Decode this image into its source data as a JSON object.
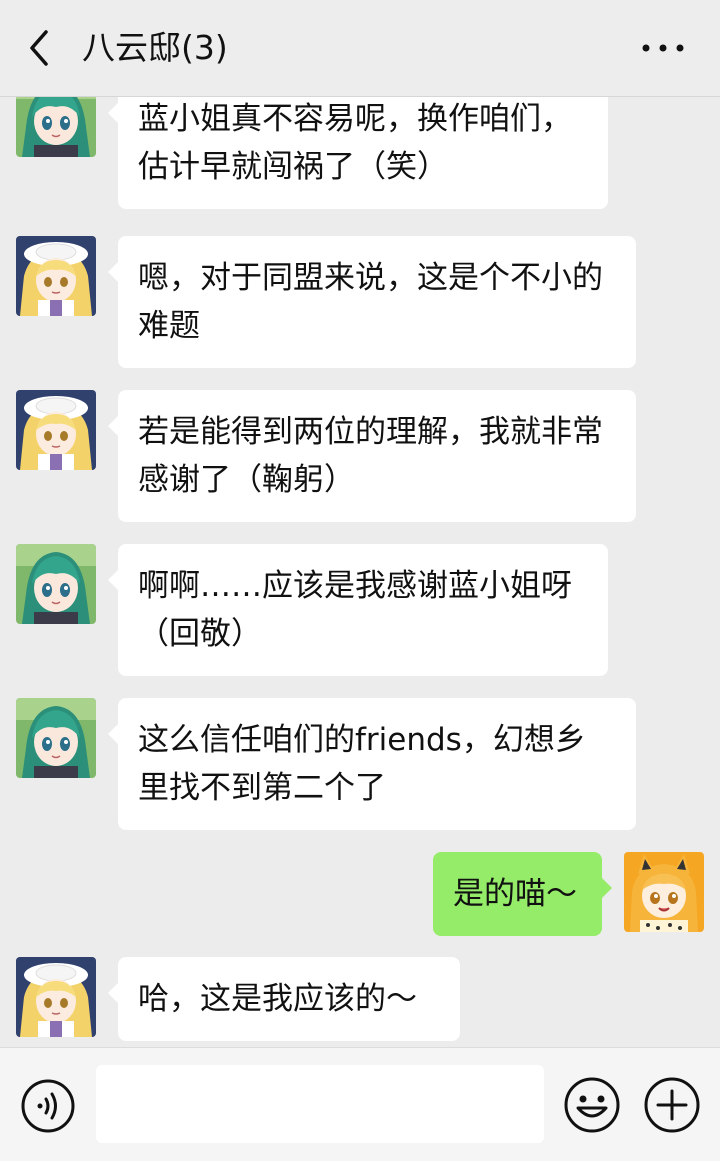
{
  "header": {
    "title": "八云邸(3)",
    "back_icon": "chevron-left-icon",
    "more_icon": "more-dots-icon"
  },
  "messages": [
    {
      "sender": "left",
      "avatar": "green-hair-avatar",
      "text": "蓝小姐真不容易呢，换作咱们，估计早就闯祸了（笑）"
    },
    {
      "sender": "left",
      "avatar": "blonde-hat-avatar",
      "text": "嗯，对于同盟来说，这是个不小的难题"
    },
    {
      "sender": "left",
      "avatar": "blonde-hat-avatar",
      "text": "若是能得到两位的理解，我就非常感谢了（鞠躬）"
    },
    {
      "sender": "left",
      "avatar": "green-hair-avatar",
      "text": "啊啊……应该是我感谢蓝小姐呀（回敬）"
    },
    {
      "sender": "left",
      "avatar": "green-hair-avatar",
      "text": "这么信任咱们的friends，幻想乡里找不到第二个了"
    },
    {
      "sender": "right",
      "avatar": "serval-avatar",
      "text": "是的喵～"
    },
    {
      "sender": "left",
      "avatar": "blonde-hat-avatar",
      "text": "哈，这是我应该的～"
    }
  ],
  "input": {
    "value": "",
    "voice_icon": "voice-icon",
    "emoji_icon": "emoji-icon",
    "plus_icon": "plus-icon"
  },
  "colors": {
    "background": "#ececec",
    "bubble_other": "#ffffff",
    "bubble_mine": "#95ec69"
  }
}
